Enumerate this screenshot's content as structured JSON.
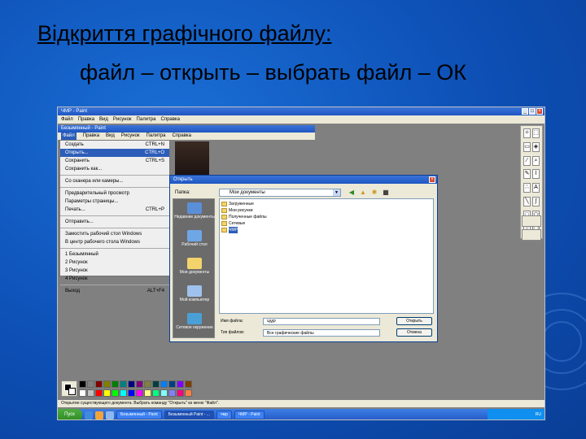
{
  "slide": {
    "title": "Відкриття графічного файлу:",
    "subtitle": "файл – открыть – выбрать файл – ОК"
  },
  "paint": {
    "window_title": "ЧМР - Paint",
    "menubar": [
      "Файл",
      "Правка",
      "Вид",
      "Рисунок",
      "Палитра",
      "Справка"
    ],
    "inner_title": "Безымянный - Paint",
    "inner_menubar": [
      "Файл",
      "Правка",
      "Вид",
      "Рисунок",
      "Палитра",
      "Справка"
    ],
    "file_menu": [
      {
        "label": "Создать",
        "shortcut": "CTRL+N",
        "selected": false
      },
      {
        "label": "Открыть...",
        "shortcut": "CTRL+O",
        "selected": true
      },
      {
        "label": "Сохранить",
        "shortcut": "CTRL+S",
        "selected": false
      },
      {
        "label": "Сохранить как...",
        "shortcut": "",
        "selected": false
      },
      {
        "sep": true
      },
      {
        "label": "Со сканера или камеры...",
        "shortcut": "",
        "selected": false
      },
      {
        "sep": true
      },
      {
        "label": "Предварительный просмотр",
        "shortcut": "",
        "selected": false
      },
      {
        "label": "Параметры страницы...",
        "shortcut": "",
        "selected": false
      },
      {
        "label": "Печать...",
        "shortcut": "CTRL+P",
        "selected": false
      },
      {
        "sep": true
      },
      {
        "label": "Отправить...",
        "shortcut": "",
        "selected": false
      },
      {
        "sep": true
      },
      {
        "label": "Замостить рабочий стол Windows",
        "shortcut": "",
        "selected": false
      },
      {
        "label": "В центр рабочего стола Windows",
        "shortcut": "",
        "selected": false
      },
      {
        "sep": true
      },
      {
        "label": "1 Безымянный",
        "shortcut": "",
        "selected": false
      },
      {
        "label": "2 Рисунок",
        "shortcut": "",
        "selected": false
      },
      {
        "label": "3 Рисунок",
        "shortcut": "",
        "selected": false
      },
      {
        "label": "4 Рисунок",
        "shortcut": "",
        "selected": false
      },
      {
        "sep": true
      },
      {
        "label": "Выход",
        "shortcut": "ALT+F4",
        "selected": false
      }
    ],
    "dialog": {
      "title": "Открыть",
      "look_in_label": "Папка:",
      "look_in_value": "Мои документы",
      "places": [
        "Недавние документы",
        "Рабочий стол",
        "Мои документы",
        "Мой компьютер",
        "Сетевое окружение"
      ],
      "files": [
        {
          "name": "Загруженные",
          "selected": false
        },
        {
          "name": "Мои рисунки",
          "selected": false
        },
        {
          "name": "Полученные файлы",
          "selected": false
        },
        {
          "name": "Сетевые",
          "selected": false
        },
        {
          "name": "ЧМР",
          "selected": true
        }
      ],
      "filename_label": "Имя файла:",
      "filename_value": "ЧМР",
      "filetype_label": "Тип файлов:",
      "filetype_value": "Все графические файлы",
      "open_button": "Открыть",
      "cancel_button": "Отмена"
    },
    "palette_colors": [
      "#000000",
      "#808080",
      "#800000",
      "#808000",
      "#008000",
      "#008080",
      "#000080",
      "#800080",
      "#808040",
      "#004040",
      "#0080ff",
      "#004080",
      "#8000ff",
      "#804000",
      "#ffffff",
      "#c0c0c0",
      "#ff0000",
      "#ffff00",
      "#00ff00",
      "#00ffff",
      "#0000ff",
      "#ff00ff",
      "#ffff80",
      "#00ff80",
      "#80ffff",
      "#8080ff",
      "#ff0080",
      "#ff8040"
    ],
    "status_text": "Открытие существующего документа. Выбрать команду \"Открыть\" из меню \"Файл\".",
    "taskbar": {
      "start": "Пуск",
      "buttons": [
        "Безымянный - Paint",
        "Безымянный Paint - ...",
        "чмр",
        "ЧМР - Paint"
      ],
      "tray": "RU"
    }
  }
}
